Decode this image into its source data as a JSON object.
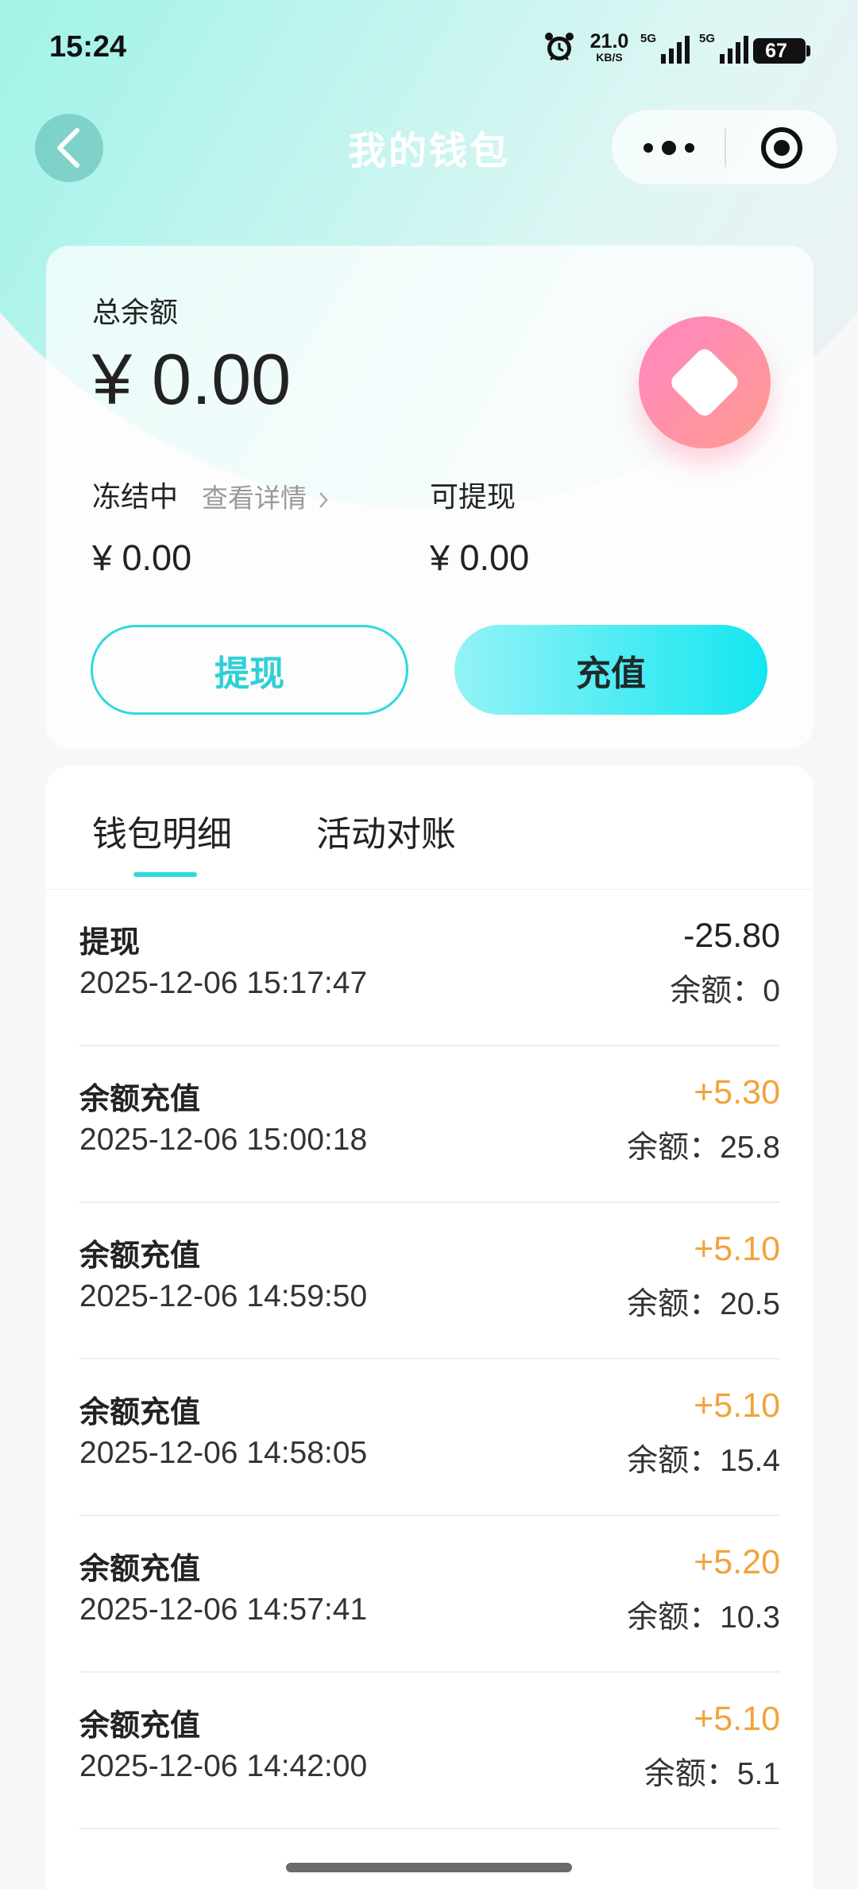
{
  "status_bar": {
    "time": "15:24",
    "net_speed_value": "21.0",
    "net_speed_unit": "KB/S",
    "signal_1_label": "5G",
    "signal_2_label": "5G",
    "battery": "67",
    "icons": [
      "alarm-icon",
      "signal-icon",
      "battery-icon"
    ]
  },
  "nav": {
    "title": "我的钱包",
    "back_icon": "chevron-left-icon",
    "more_icon": "more-dots-icon",
    "close_icon": "target-icon"
  },
  "balance": {
    "total_label": "总余额",
    "total_value": "¥ 0.00",
    "frozen_label": "冻结中",
    "frozen_detail_link": "查看详情",
    "frozen_value": "¥ 0.00",
    "withdrawable_label": "可提现",
    "withdrawable_value": "¥ 0.00",
    "withdraw_button": "提现",
    "recharge_button": "充值"
  },
  "tabs": [
    {
      "label": "钱包明细",
      "active": true
    },
    {
      "label": "活动对账",
      "active": false
    }
  ],
  "transactions": [
    {
      "title": "提现",
      "time": "2025-12-06 15:17:47",
      "amount": "-25.80",
      "balance_label": "余额：",
      "balance": "0"
    },
    {
      "title": "余额充值",
      "time": "2025-12-06 15:00:18",
      "amount": "+5.30",
      "balance_label": "余额：",
      "balance": "25.8"
    },
    {
      "title": "余额充值",
      "time": "2025-12-06 14:59:50",
      "amount": "+5.10",
      "balance_label": "余额：",
      "balance": "20.5"
    },
    {
      "title": "余额充值",
      "time": "2025-12-06 14:58:05",
      "amount": "+5.10",
      "balance_label": "余额：",
      "balance": "15.4"
    },
    {
      "title": "余额充值",
      "time": "2025-12-06 14:57:41",
      "amount": "+5.20",
      "balance_label": "余额：",
      "balance": "10.3"
    },
    {
      "title": "余额充值",
      "time": "2025-12-06 14:42:00",
      "amount": "+5.10",
      "balance_label": "余额：",
      "balance": "5.1"
    }
  ],
  "colors": {
    "accent": "#2fd9dc",
    "positive_amount": "#f2a23c",
    "coin_gradient_start": "#ff86c2",
    "coin_gradient_end": "#ff9b8f"
  }
}
